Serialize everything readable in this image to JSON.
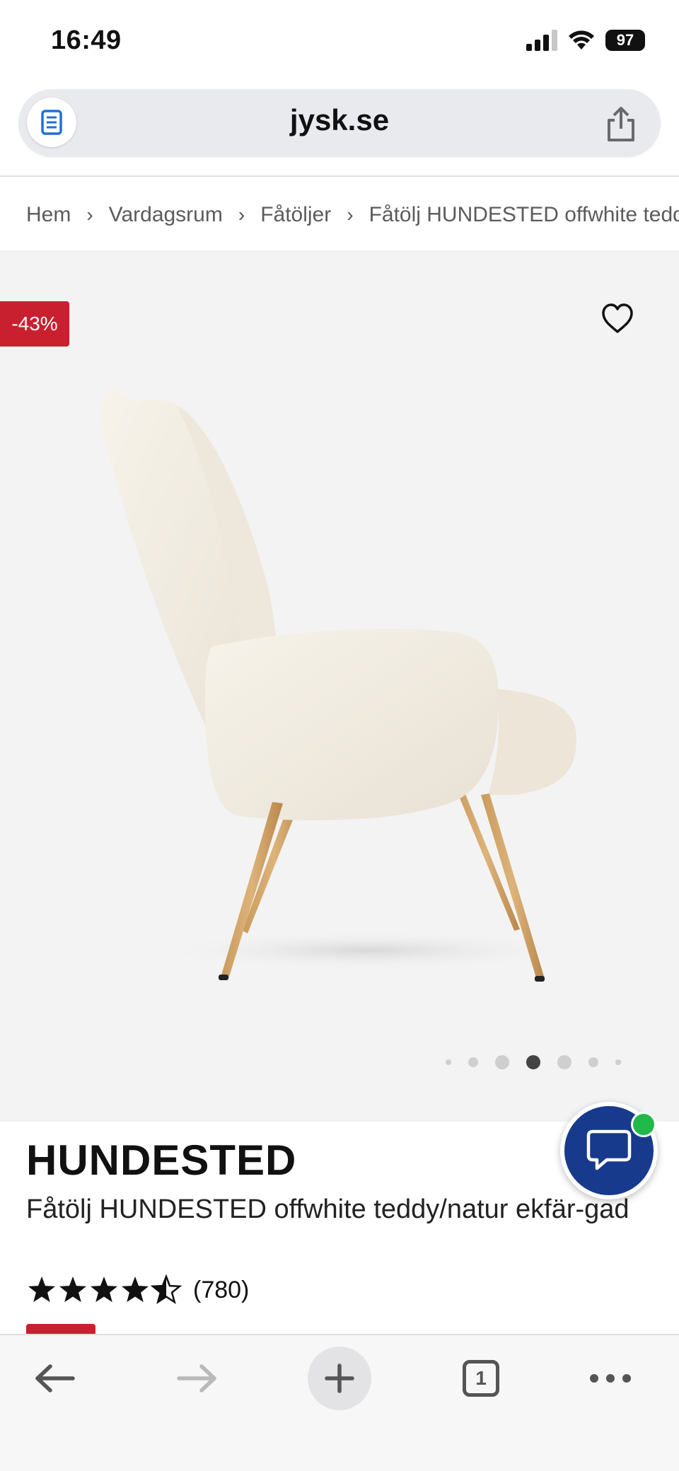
{
  "status_bar": {
    "time": "16:49",
    "battery": "97",
    "icons": [
      "signal-icon",
      "wifi-icon",
      "battery-icon"
    ]
  },
  "browser": {
    "url": "jysk.se",
    "tab_count": "1",
    "icons": [
      "reader-icon",
      "share-icon",
      "back-icon",
      "forward-icon",
      "plus-icon",
      "tabs-icon",
      "more-icon"
    ]
  },
  "breadcrumb": {
    "items": [
      "Hem",
      "Vardagsrum",
      "Fåtöljer",
      "Fåtölj HUNDESTED offwhite teddy/natur ekfärgad"
    ]
  },
  "gallery": {
    "discount_badge": "-43%",
    "image_count": 7,
    "active_image": 4
  },
  "product": {
    "name": "HUNDESTED",
    "description": "Fåtölj HUNDESTED offwhite teddy/natur ekfär-gad",
    "rating_value": 4.5,
    "rating_max": 5,
    "review_count": "(780)"
  },
  "colors": {
    "sale_red": "#c8202f",
    "chat_blue": "#173a8c",
    "online_green": "#21b94a"
  }
}
